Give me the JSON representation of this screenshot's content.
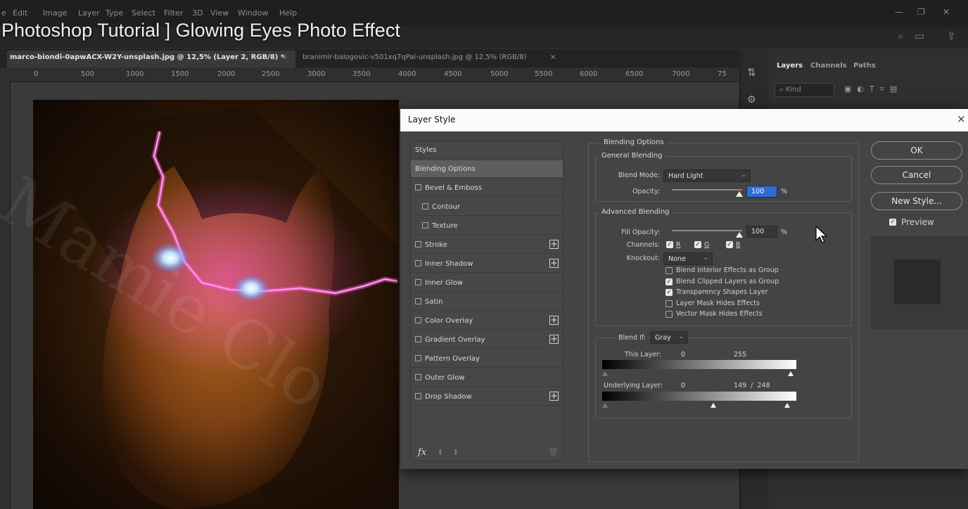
{
  "video_title": "Photoshop Tutorial ] Glowing Eyes Photo Effect",
  "menu": {
    "items": [
      "e",
      "Edit",
      "Image",
      "Layer",
      "Type",
      "Select",
      "Filter",
      "3D",
      "View",
      "Window",
      "Help"
    ]
  },
  "doc_tabs": [
    {
      "label": "marco-biondi-0apwACX-W2Y-unsplash.jpg @ 12,5% (Layer 2, RGB/8) *",
      "close": "×"
    },
    {
      "label": "branimir-balogovic-v501xq7qPal-unsplash.jpg @ 12,5% (RGB/8)",
      "close": "×"
    }
  ],
  "ruler": {
    "numbers": [
      "0",
      "500",
      "1000",
      "1500",
      "2000",
      "2500",
      "3000",
      "3500",
      "4000",
      "4500",
      "5000",
      "5500",
      "6000",
      "6500",
      "7000",
      "75"
    ]
  },
  "panels": {
    "tabs": [
      "Layers",
      "Channels",
      "Paths"
    ],
    "filter_placeholder": "Kind"
  },
  "dialog": {
    "title": "Layer Style",
    "close": "×",
    "styles": [
      {
        "label": "Styles",
        "checkbox": false,
        "indent": 0,
        "plus": false,
        "selected": false
      },
      {
        "label": "Blending Options",
        "checkbox": false,
        "indent": 0,
        "plus": false,
        "selected": true
      },
      {
        "label": "Bevel & Emboss",
        "checkbox": true,
        "indent": 0,
        "plus": false,
        "selected": false
      },
      {
        "label": "Contour",
        "checkbox": true,
        "indent": 1,
        "plus": false,
        "selected": false
      },
      {
        "label": "Texture",
        "checkbox": true,
        "indent": 1,
        "plus": false,
        "selected": false
      },
      {
        "label": "Stroke",
        "checkbox": true,
        "indent": 0,
        "plus": true,
        "selected": false
      },
      {
        "label": "Inner Shadow",
        "checkbox": true,
        "indent": 0,
        "plus": true,
        "selected": false
      },
      {
        "label": "Inner Glow",
        "checkbox": true,
        "indent": 0,
        "plus": false,
        "selected": false
      },
      {
        "label": "Satin",
        "checkbox": true,
        "indent": 0,
        "plus": false,
        "selected": false
      },
      {
        "label": "Color Overlay",
        "checkbox": true,
        "indent": 0,
        "plus": true,
        "selected": false
      },
      {
        "label": "Gradient Overlay",
        "checkbox": true,
        "indent": 0,
        "plus": true,
        "selected": false
      },
      {
        "label": "Pattern Overlay",
        "checkbox": true,
        "indent": 0,
        "plus": false,
        "selected": false
      },
      {
        "label": "Outer Glow",
        "checkbox": true,
        "indent": 0,
        "plus": false,
        "selected": false
      },
      {
        "label": "Drop Shadow",
        "checkbox": true,
        "indent": 0,
        "plus": true,
        "selected": false
      }
    ],
    "footer_fx": "fx",
    "blending_options": {
      "section_title": "Blending Options",
      "general_title": "General Blending",
      "blend_mode_label": "Blend Mode:",
      "blend_mode_value": "Hard Light",
      "opacity_label": "Opacity:",
      "opacity_value": "100",
      "percent": "%",
      "advanced_title": "Advanced Blending",
      "fill_opacity_label": "Fill Opacity:",
      "fill_opacity_value": "100",
      "channels_label": "Channels:",
      "channels": [
        "R",
        "G",
        "B"
      ],
      "knockout_label": "Knockout:",
      "knockout_value": "None",
      "checks": [
        {
          "label": "Blend Interior Effects as Group",
          "checked": false
        },
        {
          "label": "Blend Clipped Layers as Group",
          "checked": true
        },
        {
          "label": "Transparency Shapes Layer",
          "checked": true
        },
        {
          "label": "Layer Mask Hides Effects",
          "checked": false
        },
        {
          "label": "Vector Mask Hides Effects",
          "checked": false
        }
      ],
      "blend_if_label": "Blend If:",
      "blend_if_value": "Gray",
      "this_layer_label": "This Layer:",
      "this_layer_min": "0",
      "this_layer_max": "255",
      "underlying_label": "Underlying Layer:",
      "underlying_min": "0",
      "underlying_split": "149  /  248"
    },
    "buttons": {
      "ok": "OK",
      "cancel": "Cancel",
      "new_style": "New Style...",
      "preview_label": "Preview"
    }
  },
  "colors": {
    "accent_blue": "#2d6cd6",
    "lightning": "#ff4fd8"
  }
}
